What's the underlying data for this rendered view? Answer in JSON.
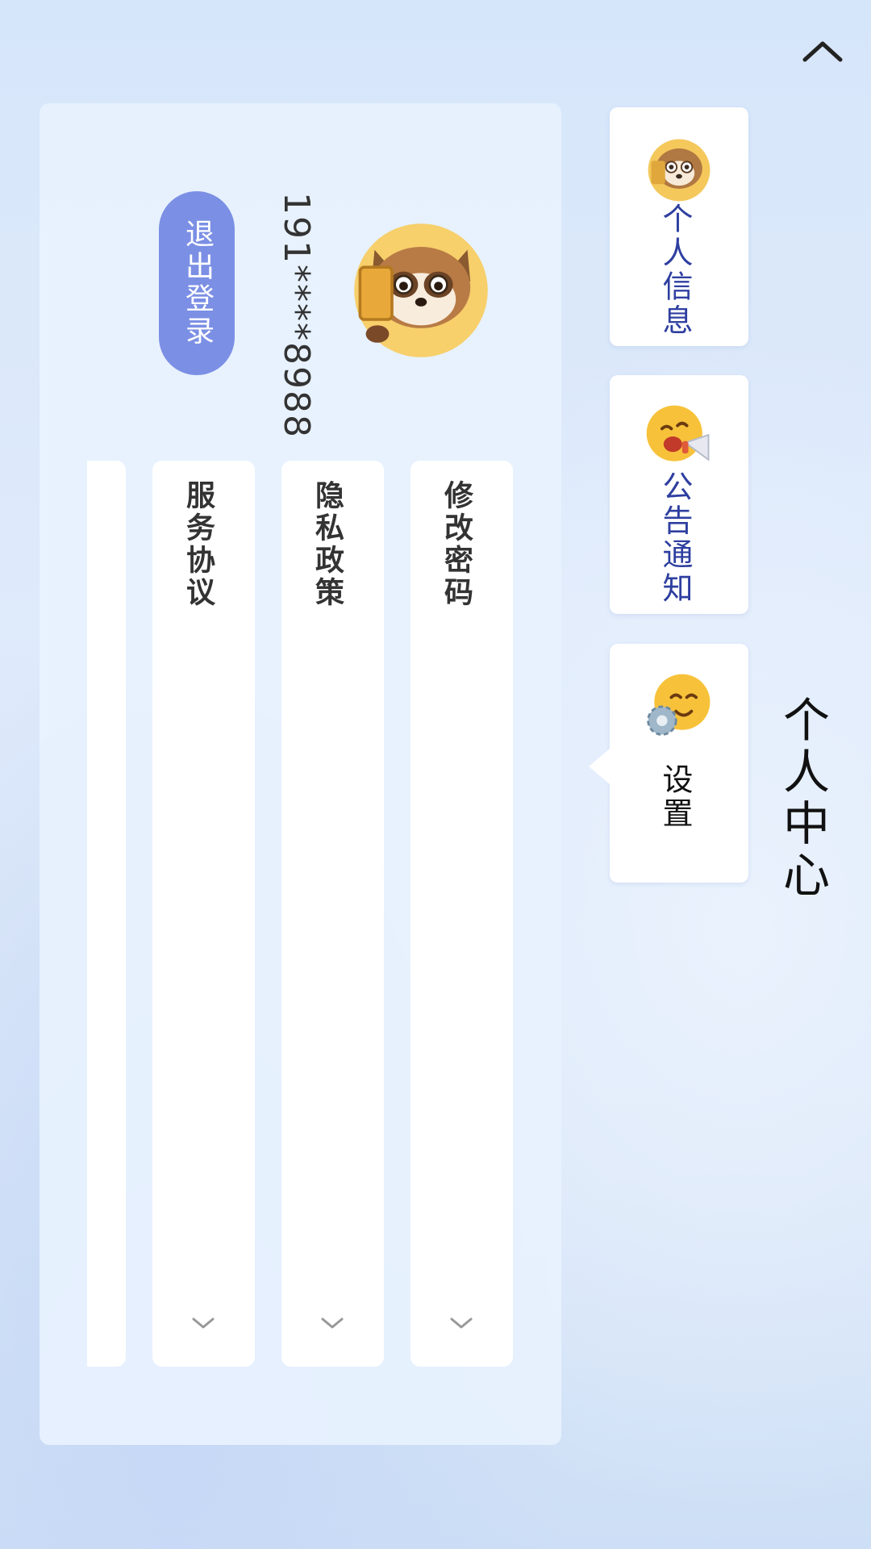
{
  "header": {
    "title": "个人中心",
    "back_icon": "chevron-up-icon"
  },
  "tabs": [
    {
      "label": "个人信息",
      "icon": "raccoon-icon",
      "active": false
    },
    {
      "label": "公告通知",
      "icon": "megaphone-emoji-icon",
      "active": false
    },
    {
      "label": "设置",
      "icon": "gear-emoji-icon",
      "active": true
    }
  ],
  "profile": {
    "avatar_icon": "raccoon-avatar-icon",
    "phone": "191****8988",
    "logout_label": "退出登录"
  },
  "menu": [
    {
      "label": "修改密码",
      "icon": "chevron-down-icon"
    },
    {
      "label": "隐私政策",
      "icon": "chevron-down-icon"
    },
    {
      "label": "服务协议",
      "icon": "chevron-down-icon"
    },
    {
      "label": ""
    }
  ],
  "colors": {
    "accent": "#7b8fe4",
    "tab_text": "#2e3fa0",
    "panel": "#e8f2fe"
  }
}
